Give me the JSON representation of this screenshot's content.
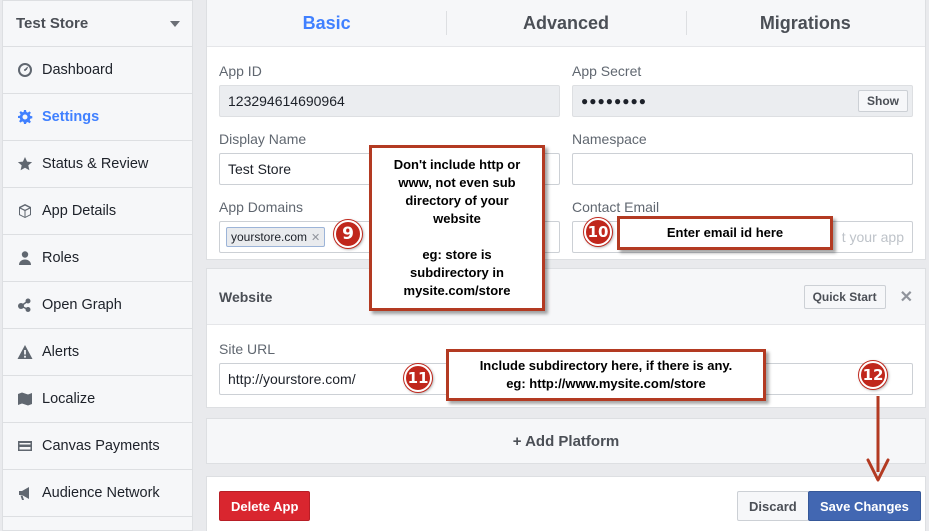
{
  "sidebar": {
    "store_name": "Test Store",
    "items": [
      {
        "label": "Dashboard",
        "icon": "dashboard-icon"
      },
      {
        "label": "Settings",
        "icon": "gear-icon",
        "active": true
      },
      {
        "label": "Status & Review",
        "icon": "star-icon"
      },
      {
        "label": "App Details",
        "icon": "cube-icon"
      },
      {
        "label": "Roles",
        "icon": "person-icon"
      },
      {
        "label": "Open Graph",
        "icon": "graph-icon"
      },
      {
        "label": "Alerts",
        "icon": "warning-icon"
      },
      {
        "label": "Localize",
        "icon": "map-icon"
      },
      {
        "label": "Canvas Payments",
        "icon": "card-icon"
      },
      {
        "label": "Audience Network",
        "icon": "megaphone-icon"
      }
    ]
  },
  "tabs": [
    "Basic",
    "Advanced",
    "Migrations"
  ],
  "basic": {
    "app_id_label": "App ID",
    "app_id_value": "123294614690964",
    "app_secret_label": "App Secret",
    "app_secret_value": "●●●●●●●●",
    "show_label": "Show",
    "display_name_label": "Display Name",
    "display_name_value": "Test Store",
    "namespace_label": "Namespace",
    "namespace_value": "",
    "app_domains_label": "App Domains",
    "app_domain_tag": "yourstore.com",
    "contact_email_label": "Contact Email",
    "contact_email_placeholder_tail": "t your app"
  },
  "website": {
    "title": "Website",
    "quick_start_label": "Quick Start",
    "site_url_label": "Site URL",
    "site_url_value": "http://yourstore.com/"
  },
  "add_platform_label": "+ Add Platform",
  "footer": {
    "delete_label": "Delete App",
    "discard_label": "Discard",
    "save_label": "Save Changes"
  },
  "annotations": {
    "note_domains": "Don't include http or\nwww, not even sub\ndirectory of your\nwebsite\n\neg: store is\nsubdirectory in\nmysite.com/store",
    "note_email": "Enter email id here",
    "note_site_url": "Include subdirectory here, if there is any.\neg: http://www.mysite.com/store",
    "badge_9": "9",
    "badge_10": "10",
    "badge_11": "11",
    "badge_12": "12",
    "color": "#b33a22"
  },
  "colors": {
    "accent": "#4080ff",
    "save_blue": "#4267b2",
    "delete_red": "#d9262f"
  }
}
